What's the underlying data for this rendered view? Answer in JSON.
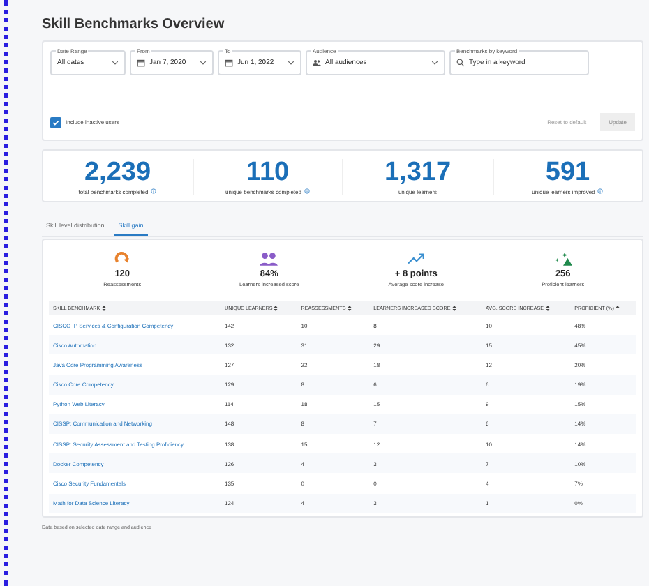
{
  "title": "Skill Benchmarks Overview",
  "filters": [
    {
      "kind": "select",
      "label": "Date Range",
      "value": "All dates"
    },
    {
      "kind": "date",
      "label": "From",
      "value": "Jan 7, 2020"
    },
    {
      "kind": "date",
      "label": "To",
      "value": "Jun 1, 2022"
    },
    {
      "kind": "audience",
      "label": "Audience",
      "value": "All audiences"
    },
    {
      "kind": "search",
      "label": "Benchmarks by keyword",
      "placeholder": "Type in a keyword"
    }
  ],
  "include_inactive": {
    "label": "Include inactive users",
    "checked": true
  },
  "buttons": [
    {
      "label": "Reset to default",
      "disabled": true
    },
    {
      "label": "Update",
      "disabled": true
    }
  ],
  "stats": [
    {
      "value": "2,239",
      "label": "total benchmarks completed",
      "info": true
    },
    {
      "value": "110",
      "label": "unique benchmarks completed",
      "info": true
    },
    {
      "value": "1,317",
      "label": "unique learners",
      "info": false
    },
    {
      "value": "591",
      "label": "unique learners improved",
      "info": true
    }
  ],
  "tabs": [
    {
      "label": "Skill level distribution",
      "selected": false
    },
    {
      "label": "Skill gain",
      "selected": true
    }
  ],
  "metrics": [
    {
      "kind": "reassess",
      "value": "120",
      "label": "Reassessments"
    },
    {
      "kind": "learners",
      "value": "84%",
      "label": "Learners increased score"
    },
    {
      "kind": "trend",
      "value": "+ 8 points",
      "label": "Average score increase"
    },
    {
      "kind": "proficient",
      "value": "256",
      "label": "Proficient learners"
    }
  ],
  "table": {
    "columns": [
      {
        "label": "SKILL BENCHMARK",
        "sorted": false
      },
      {
        "label": "UNIQUE LEARNERS",
        "sorted": false
      },
      {
        "label": "REASSESSMENTS",
        "sorted": false
      },
      {
        "label": "LEARNERS INCREASED SCORE",
        "sorted": false
      },
      {
        "label": "AVG. SCORE INCREASE",
        "sorted": false
      },
      {
        "label": "PROFICIENT (%)",
        "sorted": true
      }
    ],
    "rows": [
      [
        "CISCO IP Services & Configuration Competency",
        "142",
        "10",
        "8",
        "10",
        "48%"
      ],
      [
        "Cisco Automation",
        "132",
        "31",
        "29",
        "15",
        "45%"
      ],
      [
        "Java Core Programming Awareness",
        "127",
        "22",
        "18",
        "12",
        "20%"
      ],
      [
        "Cisco Core Competency",
        "129",
        "8",
        "6",
        "6",
        "19%"
      ],
      [
        "Python Web Literacy",
        "114",
        "18",
        "15",
        "9",
        "15%"
      ],
      [
        "CISSP: Communication and Networking",
        "148",
        "8",
        "7",
        "6",
        "14%"
      ],
      [
        "CISSP: Security Assessment and Testing Proficiency",
        "138",
        "15",
        "12",
        "10",
        "14%"
      ],
      [
        "Docker Competency",
        "126",
        "4",
        "3",
        "7",
        "10%"
      ],
      [
        "Cisco Security Fundamentals",
        "135",
        "0",
        "0",
        "4",
        "7%"
      ],
      [
        "Math for Data Science Literacy",
        "124",
        "4",
        "3",
        "1",
        "0%"
      ]
    ]
  },
  "footnote": "Data based on selected date range and audience"
}
